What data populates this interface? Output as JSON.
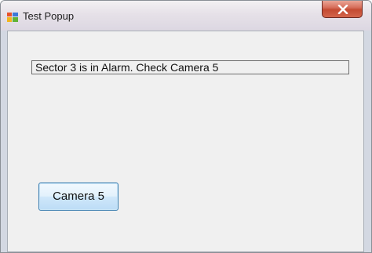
{
  "window": {
    "title": "Test Popup",
    "icon": "app-window-icon",
    "close_icon": "close-icon"
  },
  "form": {
    "message": "Sector 3 is in Alarm. Check Camera 5",
    "button_label": "Camera 5"
  },
  "colors": {
    "close_button": "#c44a32",
    "client_background": "#f0f0f0",
    "button_border": "#3c7fb1"
  }
}
